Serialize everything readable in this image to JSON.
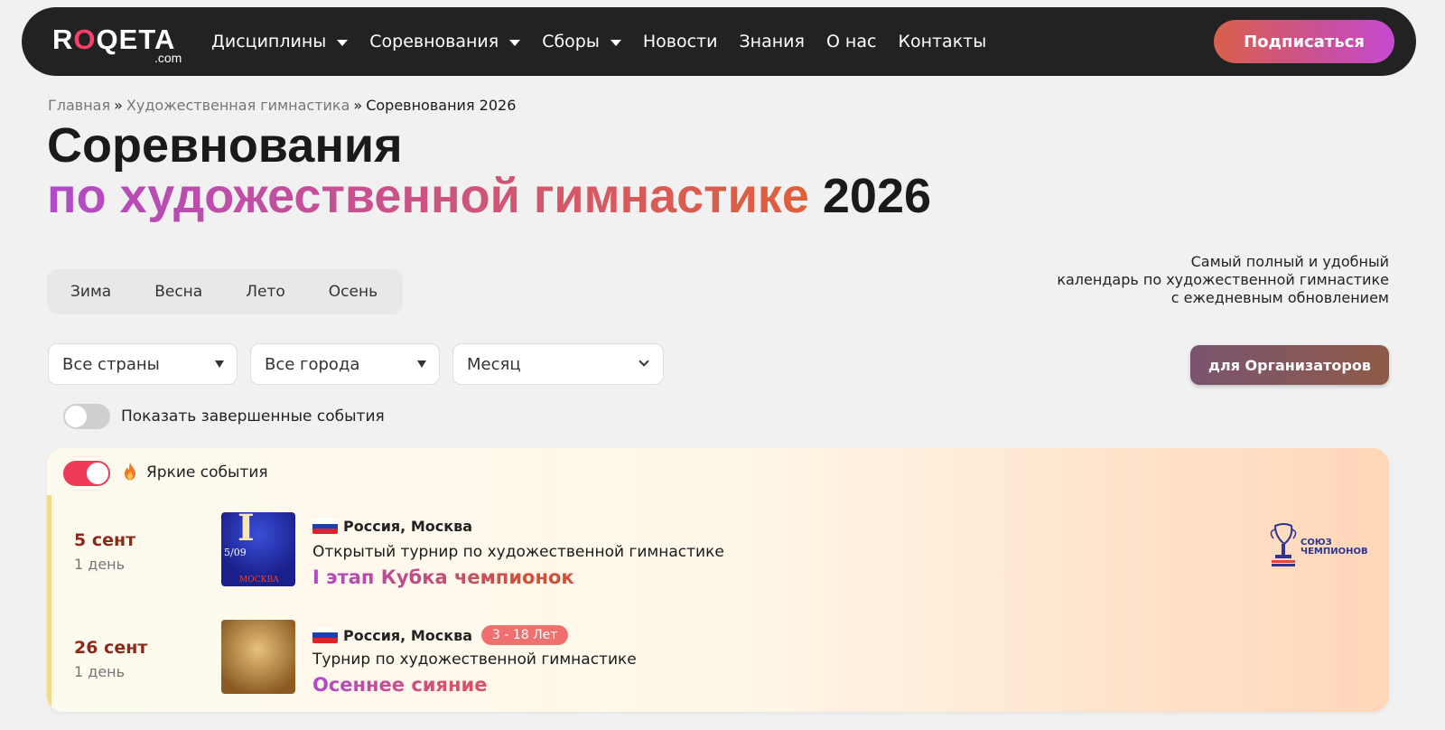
{
  "header": {
    "logo_main": "ROQETA",
    "logo_sub": ".com",
    "nav": [
      {
        "label": "Дисциплины",
        "has_dropdown": true
      },
      {
        "label": "Соревнования",
        "has_dropdown": true
      },
      {
        "label": "Сборы",
        "has_dropdown": true
      },
      {
        "label": "Новости",
        "has_dropdown": false
      },
      {
        "label": "Знания",
        "has_dropdown": false
      },
      {
        "label": "О нас",
        "has_dropdown": false
      },
      {
        "label": "Контакты",
        "has_dropdown": false
      }
    ],
    "subscribe_label": "Подписаться"
  },
  "breadcrumb": {
    "home": "Главная",
    "sep": "»",
    "section": "Художественная гимнастика",
    "current": "Соревнования 2026"
  },
  "title": {
    "line1": "Соревнования",
    "line2_highlight": "по художественной гимнастике",
    "line2_year": "2026"
  },
  "seasons": [
    "Зима",
    "Весна",
    "Лето",
    "Осень"
  ],
  "tagline": {
    "line1": "Самый полный и удобный",
    "line2": "календарь по художественной гимнастике",
    "line3": "с ежедневным обновлением"
  },
  "filters": {
    "country": "Все страны",
    "city": "Все города",
    "month": "Месяц"
  },
  "organizers_label": "для Организаторов",
  "show_completed": {
    "label": "Показать завершенные события",
    "on": false
  },
  "bright_events": {
    "label": "Яркие события",
    "on": true
  },
  "events": [
    {
      "date": "5 сент",
      "duration": "1 день",
      "location": "Россия, Москва",
      "age": "",
      "type": "Открытый турнир по художественной гимнастике",
      "title": "I этап Кубка чемпионок",
      "poster_text": "5/09",
      "poster_roman": "I",
      "poster_city": "МОСКВА"
    },
    {
      "date": "26 сент",
      "duration": "1 день",
      "location": "Россия, Москва",
      "age": "3 - 18 Лет",
      "type": "Турнир по художественной гимнастике",
      "title": "Осеннее сияние",
      "poster_text": "",
      "poster_roman": "",
      "poster_city": ""
    }
  ],
  "org_logo": {
    "line1": "СОЮЗ",
    "line2": "ЧЕМПИОНОВ"
  },
  "colors": {
    "accent_gradient_start": "#b04ac8",
    "accent_gradient_end": "#e0603a",
    "toggle_on": "#f03a5a",
    "navbar": "#222222"
  }
}
